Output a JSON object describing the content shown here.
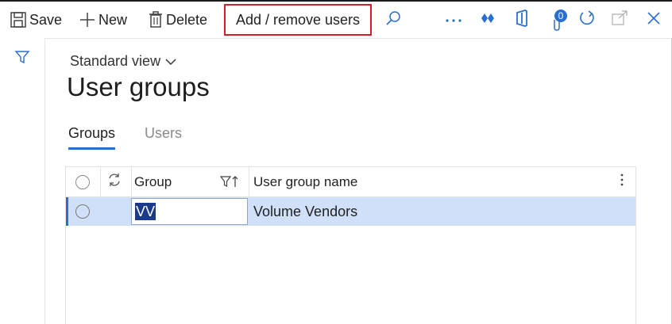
{
  "toolbar": {
    "save_label": "Save",
    "new_label": "New",
    "delete_label": "Delete",
    "add_remove_label": "Add / remove users",
    "badge_count": "0"
  },
  "view": {
    "label": "Standard view"
  },
  "page": {
    "title": "User groups"
  },
  "tabs": [
    {
      "label": "Groups",
      "active": true
    },
    {
      "label": "Users",
      "active": false
    }
  ],
  "grid": {
    "columns": [
      "Group",
      "User group name"
    ],
    "rows": [
      {
        "group": "VV",
        "name": "Volume Vendors",
        "selected": true
      }
    ]
  },
  "colors": {
    "accent": "#2a6ed1",
    "highlight_border": "#d01f26",
    "selected_row": "#cfe0f8"
  }
}
